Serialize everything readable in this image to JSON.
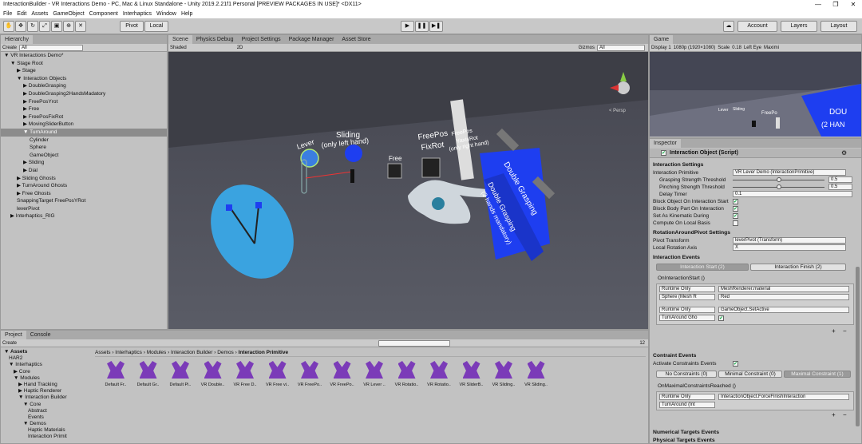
{
  "window": {
    "title": "InteractionBuilder - VR Interactions Demo - PC, Mac & Linux Standalone - Unity 2019.2.21f1 Personal [PREVIEW PACKAGES IN USE]* <DX11>",
    "controls": [
      "—",
      "❐",
      "✕"
    ]
  },
  "menu": [
    "File",
    "Edit",
    "Assets",
    "GameObject",
    "Component",
    "Interhaptics",
    "Window",
    "Help"
  ],
  "toolbar": {
    "pivot": "Pivot",
    "local": "Local",
    "play": "▶",
    "pause": "❚❚",
    "step": "▶❚",
    "account": "Account",
    "layers": "Layers",
    "layout": "Layout"
  },
  "hierarchy": {
    "tab": "Hierarchy",
    "create": "Create",
    "search_placeholder": "All",
    "items": [
      {
        "label": "▼ VR Interactions Demo*",
        "indent": 0,
        "sel": false
      },
      {
        "label": "▼ Stage Root",
        "indent": 1,
        "sel": false
      },
      {
        "label": "▶ Stage",
        "indent": 2,
        "sel": false
      },
      {
        "label": "▼ Interaction Objects",
        "indent": 2,
        "sel": false
      },
      {
        "label": "▶ DoubleGrasping",
        "indent": 3,
        "sel": false
      },
      {
        "label": "▶ DoubleGrasping2HandsMadatory",
        "indent": 3,
        "sel": false
      },
      {
        "label": "▶ FreePosYrot",
        "indent": 3,
        "sel": false
      },
      {
        "label": "▶ Free",
        "indent": 3,
        "sel": false
      },
      {
        "label": "▶ FreePosFixRot",
        "indent": 3,
        "sel": false
      },
      {
        "label": "▶ MovingSliderButton",
        "indent": 3,
        "sel": false
      },
      {
        "label": "▼ TurnAround",
        "indent": 3,
        "sel": true
      },
      {
        "label": "Cylinder",
        "indent": 4,
        "sel": false
      },
      {
        "label": "Sphere",
        "indent": 4,
        "sel": false
      },
      {
        "label": "GameObject",
        "indent": 4,
        "sel": false
      },
      {
        "label": "▶ Sliding",
        "indent": 3,
        "sel": false
      },
      {
        "label": "▶ Dial",
        "indent": 3,
        "sel": false
      },
      {
        "label": "▶ Sliding Ghosts",
        "indent": 2,
        "sel": false
      },
      {
        "label": "▶ TurnAround Ghosts",
        "indent": 2,
        "sel": false
      },
      {
        "label": "▶ Free Ghosts",
        "indent": 2,
        "sel": false
      },
      {
        "label": "SnappingTarget FreePosYRot",
        "indent": 2,
        "sel": false
      },
      {
        "label": "leverPivot",
        "indent": 2,
        "sel": false
      },
      {
        "label": "▶ Interhaptics_RIG",
        "indent": 1,
        "sel": false
      }
    ]
  },
  "scene": {
    "tabs": [
      "Scene",
      "Physics Debug",
      "Project Settings",
      "Package Manager",
      "Asset Store"
    ],
    "shading": "Shaded",
    "mode": "2D",
    "gizmos": "Gizmos",
    "search_placeholder": "All",
    "persp": "< Persp",
    "labels": {
      "lever": "Lever",
      "sliding": "Sliding",
      "sliding2": "(only left hand)",
      "free": "Free",
      "freepos": "FreePos",
      "fixrot": "FixRot",
      "freepos2": "FreePos",
      "yaxis": "YaxisRot",
      "righthand": "(only right hand)",
      "dg": "Double Grasping",
      "dg2": "Double Grasping",
      "dg2b": "(2 hands mandatory)"
    }
  },
  "game": {
    "tab": "Game",
    "display": "Display 1",
    "res": "1080p (1920×1080)",
    "scale": "Scale",
    "scale_val": "0.18",
    "lefteye": "Left Eye",
    "maxim": "Maximi",
    "labels": {
      "a": "DOU",
      "b": "(2 HAN",
      "c": "FreePo",
      "d": "Lever",
      "e": "Sliding"
    }
  },
  "inspector": {
    "tab": "Inspector",
    "component": "Interaction Object (Script)",
    "settings_header": "Interaction Settings",
    "primitive_label": "Interaction Primitive",
    "primitive_value": "VR Lever Demo (InteractionPrimitive)",
    "grasp_label": "Grasping Strength Threshold",
    "grasp_value": "0.5",
    "pinch_label": "Pinching Strength Threshold",
    "pinch_value": "0.5",
    "delay_label": "Delay Timer",
    "delay_value": "0.1",
    "block_interaction": "Block Object On Interaction Start",
    "block_body": "Block Body Part On Interaction",
    "kinematic": "Set As Kinematic During Interaction",
    "compute_local": "Compute On Local Basis",
    "pivot_header": "RotationAroundPivot Settings",
    "pivot_label": "Pivot Transform",
    "pivot_value": "leverPivot (Transform)",
    "axis_label": "Local Rotation Axis",
    "axis_value": "X",
    "events_header": "Interaction Events",
    "start_tab": "Interaction Start (2)",
    "finish_tab": "Interaction Finish (2)",
    "on_start": "OnInteractionStart ()",
    "runtime": "Runtime Only",
    "ev1_func": "MeshRenderer.material",
    "ev1_obj": "Sphere (Mesh R",
    "ev1_arg": "Red",
    "ev2_func": "GameObject.SetActive",
    "ev2_obj": "TurnAround Gho",
    "plus": "+",
    "minus": "−",
    "constraint_header": "Contraint Events",
    "activate_label": "Activate Constraints Events",
    "no_c": "No Constraints (0)",
    "min_c": "Minimal Constraint (0)",
    "max_c": "Maximal Constraint (1)",
    "on_max": "OnMaximalConstraintsReached ()",
    "ev3_func": "InteractionObject.ForceFinishInteraction",
    "ev3_obj": "TurnAround (Int",
    "numerical": "Numerical Targets Events",
    "physical": "Physical Targets Events"
  },
  "project": {
    "tabs": [
      "Project",
      "Console"
    ],
    "create": "Create",
    "breadcrumb": [
      "Assets",
      "Interhaptics",
      "Modules",
      "Interaction Builder",
      "Demos",
      "Interaction Primitive"
    ],
    "count": "12",
    "tree": [
      {
        "label": "▼ Assets",
        "indent": 0,
        "bold": true
      },
      {
        "label": "HAR2",
        "indent": 1
      },
      {
        "label": "▼ Interhaptics",
        "indent": 1
      },
      {
        "label": "▶ Core",
        "indent": 2
      },
      {
        "label": "▼ Modules",
        "indent": 2
      },
      {
        "label": "▶ Hand Tracking",
        "indent": 3
      },
      {
        "label": "▶ Haptic Renderer",
        "indent": 3
      },
      {
        "label": "▼ Interaction Builder",
        "indent": 3
      },
      {
        "label": "▼ Core",
        "indent": 4
      },
      {
        "label": "Abstract",
        "indent": 5
      },
      {
        "label": "Events",
        "indent": 5
      },
      {
        "label": "▼ Demos",
        "indent": 4
      },
      {
        "label": "Haptic Materials",
        "indent": 5
      },
      {
        "label": "Interaction Primit",
        "indent": 5
      }
    ],
    "assets": [
      "Default Fr..",
      "Default Gr..",
      "Default Pi..",
      "VR Double..",
      "VR Free D..",
      "VR Free vi..",
      "VR FreePo..",
      "VR FreePo..",
      "VR Lever ..",
      "VR Rotatio..",
      "VR Rotatio..",
      "VR SliderB..",
      "VR Sliding..",
      "VR Sliding.."
    ]
  },
  "colors": {
    "accent": "#3a8ee6",
    "scene_bg": "#4f5058",
    "blue_obj": "#1e3ef0"
  }
}
